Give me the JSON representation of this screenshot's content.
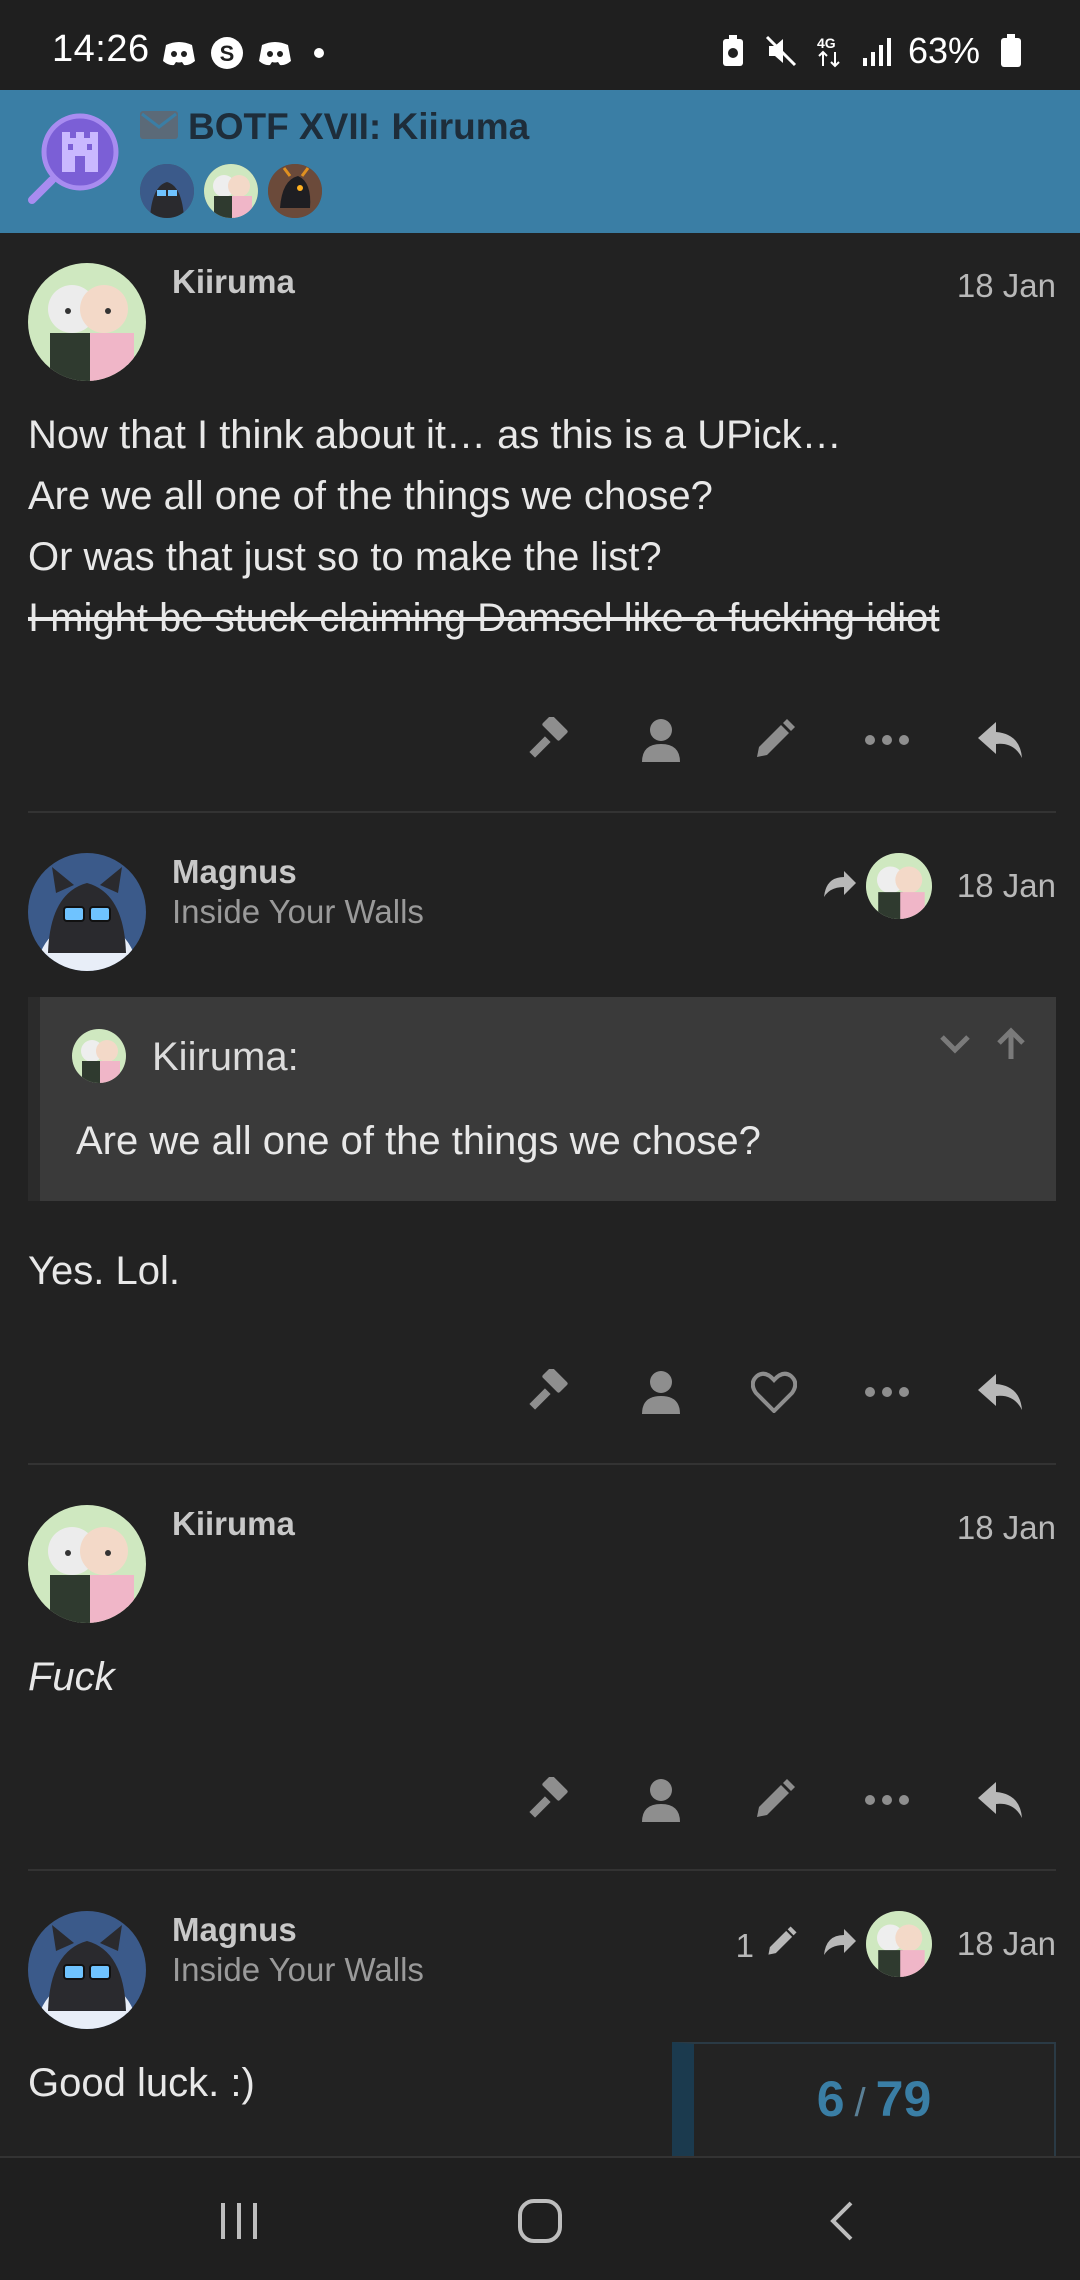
{
  "status_bar": {
    "time": "14:26",
    "battery": "63%",
    "network": "4G",
    "icons": [
      "discord-icon",
      "s-icon",
      "discord-icon",
      "dot",
      "battery-saver-icon",
      "mute-icon",
      "network-icon",
      "signal-icon",
      "battery-icon"
    ]
  },
  "topic": {
    "title": "BOTF XVII: Kiiruma",
    "type_icon": "envelope-icon",
    "logo": "magnifier-castle-logo",
    "participants": [
      "Magnus",
      "Kiiruma",
      "dragon-user"
    ]
  },
  "posts": [
    {
      "username": "Kiiruma",
      "user_title": "",
      "date": "18 Jan",
      "lines": [
        "Now that I think about it… as this is a UPick…",
        "Are we all one of the things we chose?",
        "Or was that just so to make the list?"
      ],
      "struck_line": "I might be stuck claiming Damsel like a fucking idiot",
      "actions": [
        "hammer-icon",
        "user-icon",
        "edit-icon",
        "more-icon",
        "reply-icon"
      ]
    },
    {
      "username": "Magnus",
      "user_title": "Inside Your Walls",
      "date": "18 Jan",
      "reply_to": "Kiiruma",
      "quote": {
        "author": "Kiiruma:",
        "text": "Are we all one of the things we chose?"
      },
      "text": "Yes. Lol.",
      "actions": [
        "hammer-icon",
        "user-icon",
        "heart-icon",
        "more-icon",
        "reply-icon"
      ]
    },
    {
      "username": "Kiiruma",
      "user_title": "",
      "date": "18 Jan",
      "text": "Fuck",
      "actions": [
        "hammer-icon",
        "user-icon",
        "edit-icon",
        "more-icon",
        "reply-icon"
      ]
    },
    {
      "username": "Magnus",
      "user_title": "Inside Your Walls",
      "date": "18 Jan",
      "edit_count": "1",
      "reply_to": "Kiiruma",
      "text": "Good luck. :)"
    }
  ],
  "progress": {
    "current": "6",
    "separator": "/",
    "total": "79"
  },
  "nav": [
    "recents-icon",
    "home-icon",
    "back-icon"
  ]
}
